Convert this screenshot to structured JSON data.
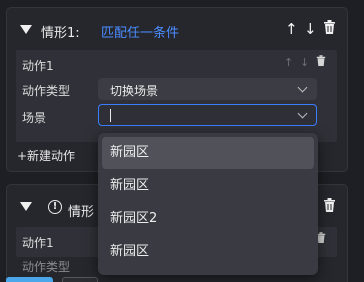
{
  "panel1": {
    "title": "情形1:",
    "condition_link": "匹配任一条件",
    "icons": [
      "arrow-up-icon",
      "arrow-down-icon",
      "trash-icon"
    ],
    "action": {
      "name": "动作1",
      "type_label": "动作类型",
      "type_value": "切换场景",
      "scene_label": "场景",
      "scene_value": ""
    },
    "add_action": "+新建动作"
  },
  "panel2": {
    "title_partial": "情形",
    "action_name": "动作1",
    "type_label_partial": "动作类型"
  },
  "dropdown": {
    "options": [
      "新园区",
      "新园区",
      "新园区2",
      "新园区"
    ],
    "highlighted_index": 0
  },
  "colors": {
    "accent": "#4a8cff",
    "focus_border": "#3b7dff",
    "primary_button": "#4aa8ea"
  }
}
